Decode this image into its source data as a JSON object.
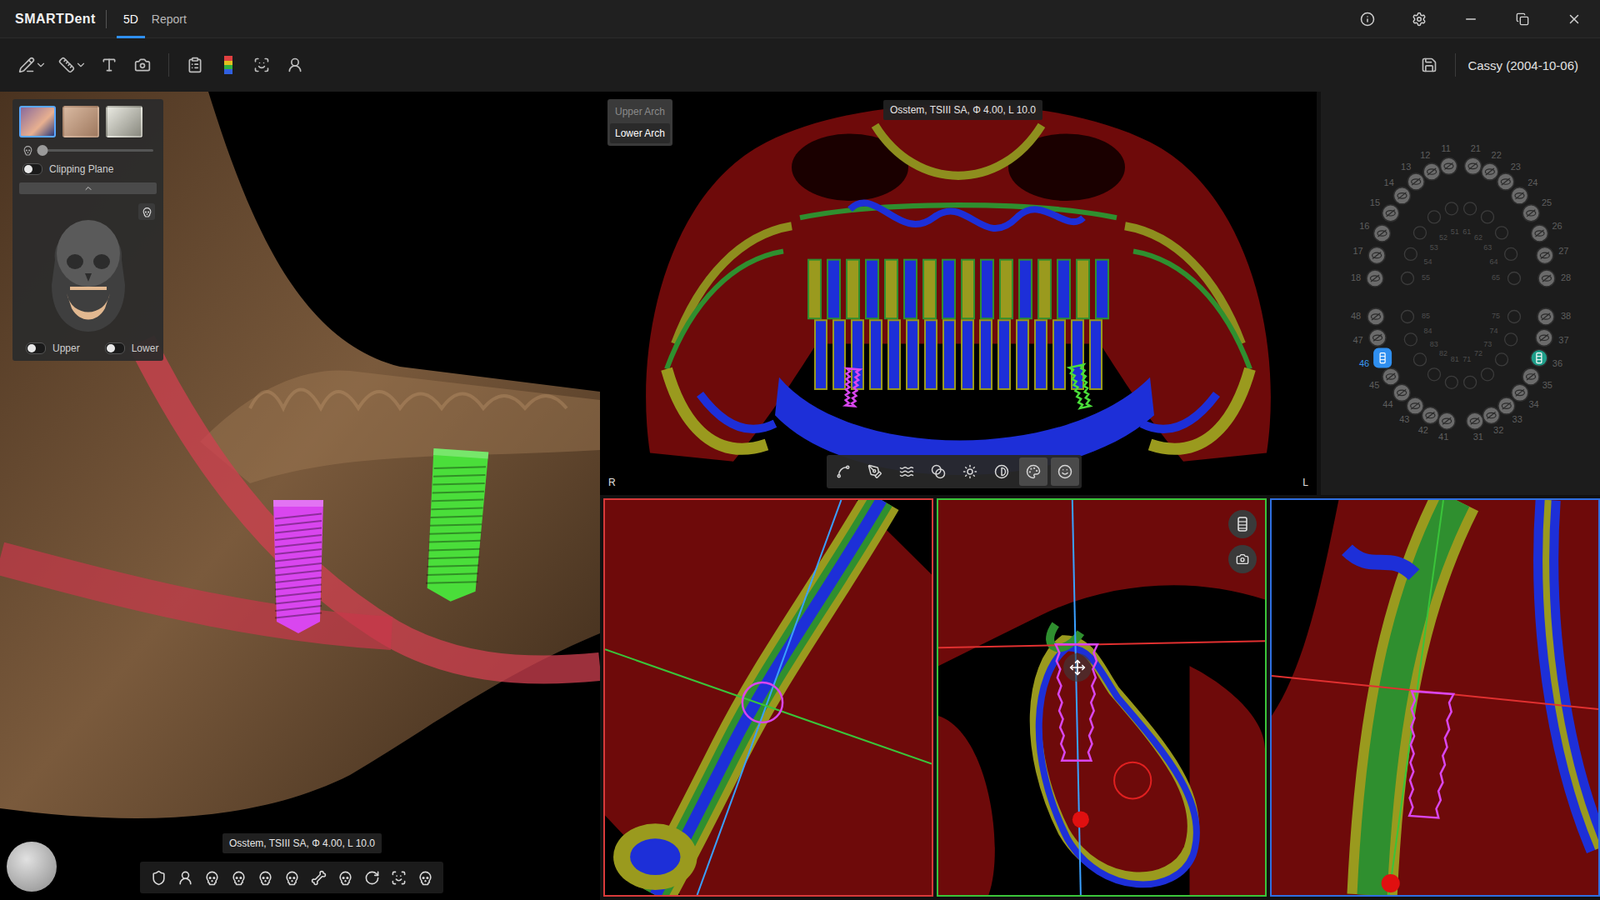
{
  "app": {
    "logo": "SMARTDent"
  },
  "tabs": [
    {
      "label": "5D",
      "selected": true
    },
    {
      "label": "Report",
      "selected": false
    }
  ],
  "patient": {
    "label": "Cassy (2004-10-06)"
  },
  "view3d": {
    "view_modes": [
      {
        "selected": true
      },
      {
        "selected": false
      },
      {
        "selected": false
      }
    ],
    "opacity_level": 0.02,
    "clipping_plane": {
      "label": "Clipping Plane",
      "on": false
    },
    "jaw_toggles": [
      {
        "label": "Upper",
        "on": false
      },
      {
        "label": "Lower",
        "on": false
      }
    ],
    "implant_tooltip": "Osstem, TSIII SA, Φ 4.00, L 10.0"
  },
  "panoramic": {
    "arches": [
      {
        "label": "Upper Arch",
        "selected": false
      },
      {
        "label": "Lower Arch",
        "selected": true
      }
    ],
    "implant_label": "Osstem, TSIII SA, Φ 4.00, L 10.0",
    "side_left": "R",
    "side_right": "L",
    "tools": [
      {
        "selected": false
      },
      {
        "selected": false
      },
      {
        "selected": false
      },
      {
        "selected": false
      },
      {
        "selected": false
      },
      {
        "selected": false
      },
      {
        "selected": true
      },
      {
        "selected": true
      }
    ]
  },
  "implants": [
    {
      "tooth": "46",
      "color": "#d946ef"
    },
    {
      "tooth": "36",
      "color": "#4ade3a"
    }
  ],
  "tooth_chart": {
    "upper": [
      {
        "number": "18",
        "implant": false,
        "selected": false
      },
      {
        "number": "17",
        "implant": false,
        "selected": false
      },
      {
        "number": "16",
        "implant": false,
        "selected": false
      },
      {
        "number": "15",
        "implant": false,
        "selected": false
      },
      {
        "number": "14",
        "implant": false,
        "selected": false
      },
      {
        "number": "13",
        "implant": false,
        "selected": false
      },
      {
        "number": "12",
        "implant": false,
        "selected": false
      },
      {
        "number": "11",
        "implant": false,
        "selected": false
      },
      {
        "number": "21",
        "implant": false,
        "selected": false
      },
      {
        "number": "22",
        "implant": false,
        "selected": false
      },
      {
        "number": "23",
        "implant": false,
        "selected": false
      },
      {
        "number": "24",
        "implant": false,
        "selected": false
      },
      {
        "number": "25",
        "implant": false,
        "selected": false
      },
      {
        "number": "26",
        "implant": false,
        "selected": false
      },
      {
        "number": "27",
        "implant": false,
        "selected": false
      },
      {
        "number": "28",
        "implant": false,
        "selected": false
      }
    ],
    "upper_deciduous": [
      "55",
      "54",
      "53",
      "52",
      "51",
      "61",
      "62",
      "63",
      "64",
      "65"
    ],
    "lower": [
      {
        "number": "48",
        "implant": false,
        "selected": false
      },
      {
        "number": "47",
        "implant": false,
        "selected": false
      },
      {
        "number": "46",
        "implant": true,
        "selected": true
      },
      {
        "number": "45",
        "implant": false,
        "selected": false
      },
      {
        "number": "44",
        "implant": false,
        "selected": false
      },
      {
        "number": "43",
        "implant": false,
        "selected": false
      },
      {
        "number": "42",
        "implant": false,
        "selected": false
      },
      {
        "number": "41",
        "implant": false,
        "selected": false
      },
      {
        "number": "31",
        "implant": false,
        "selected": false
      },
      {
        "number": "32",
        "implant": false,
        "selected": false
      },
      {
        "number": "33",
        "implant": false,
        "selected": false
      },
      {
        "number": "34",
        "implant": false,
        "selected": false
      },
      {
        "number": "35",
        "implant": false,
        "selected": false
      },
      {
        "number": "36",
        "implant": true,
        "selected": false
      },
      {
        "number": "37",
        "implant": false,
        "selected": false
      },
      {
        "number": "38",
        "implant": false,
        "selected": false
      }
    ],
    "lower_deciduous": [
      "85",
      "84",
      "83",
      "82",
      "81",
      "71",
      "72",
      "73",
      "74",
      "75"
    ]
  },
  "sections": [
    {
      "color": "#d83a3a"
    },
    {
      "color": "#3ac43a"
    },
    {
      "color": "#2f6fe0"
    }
  ]
}
